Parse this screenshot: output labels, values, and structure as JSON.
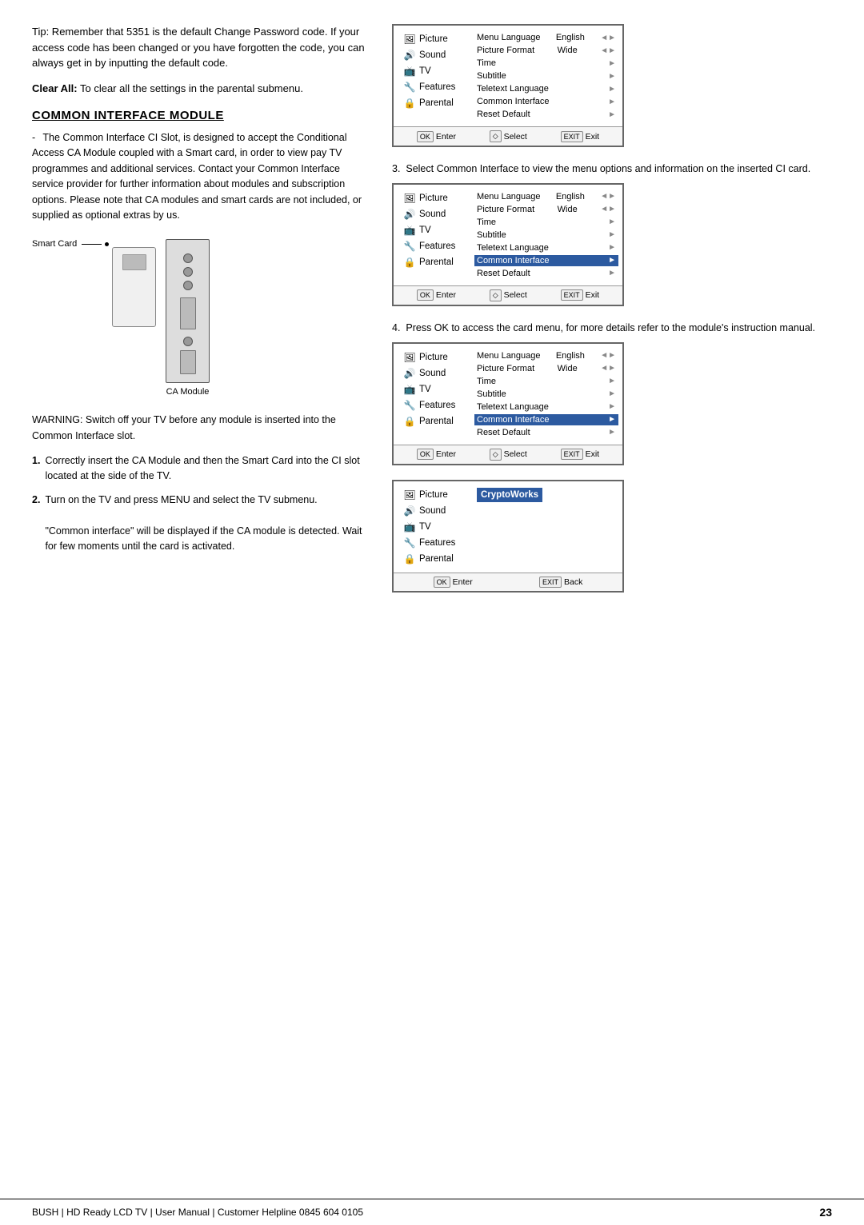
{
  "page": {
    "footer_text": "BUSH | HD Ready LCD TV | User Manual | Customer Helpline 0845 604 0105",
    "page_number": "23"
  },
  "left": {
    "tip": "Tip: Remember that 5351 is the default Change Password code. If your access code has been changed or you have forgotten the code, you can always get in by inputting the default code.",
    "clear_all_label": "Clear All:",
    "clear_all_text": "To clear all the settings in the parental submenu.",
    "section_heading": "COMMON INTERFACE MODULE",
    "body1": "The Common Interface CI Slot, is designed to accept the Conditional Access CA Module coupled with a Smart card, in order to view pay TV programmes and additional services. Contact your Common Interface service provider for further information about modules and subscription options. Please note that CA modules and smart cards are not included, or supplied as optional extras by us.",
    "smart_card_label": "Smart Card",
    "ca_module_label": "CA Module",
    "warning": "WARNING: Switch off your TV before any module is inserted into the Common Interface slot.",
    "step1": "Correctly insert the CA Module and then the Smart Card into the CI slot located at the side of the TV.",
    "step2": "Turn on the TV and press MENU and select the TV submenu.",
    "step2b": "\"Common interface\" will be displayed if the CA module is detected. Wait for few moments until the card is activated."
  },
  "menus": [
    {
      "id": "menu1",
      "step_text": "",
      "items_left": [
        {
          "label": "Picture",
          "icon": "🖼"
        },
        {
          "label": "Sound",
          "icon": "🔊"
        },
        {
          "label": "TV",
          "icon": "📺"
        },
        {
          "label": "Features",
          "icon": "🔧"
        },
        {
          "label": "Parental",
          "icon": "🔒"
        }
      ],
      "rows_right": [
        {
          "label": "Menu Language",
          "value": "English",
          "arrow": "◄►",
          "highlighted": false
        },
        {
          "label": "Picture Format",
          "value": "Wide",
          "arrow": "◄►",
          "highlighted": false
        },
        {
          "label": "Time",
          "value": "",
          "arrow": "►",
          "highlighted": false
        },
        {
          "label": "Subtitle",
          "value": "",
          "arrow": "►",
          "highlighted": false
        },
        {
          "label": "Teletext Language",
          "value": "",
          "arrow": "►",
          "highlighted": false
        },
        {
          "label": "Common Interface",
          "value": "",
          "arrow": "►",
          "highlighted": false
        },
        {
          "label": "Reset Default",
          "value": "",
          "arrow": "►",
          "highlighted": false
        }
      ],
      "footer": [
        {
          "key": "OK",
          "label": "Enter"
        },
        {
          "key": "◇",
          "label": "Select"
        },
        {
          "key": "EXIT",
          "label": "Exit"
        }
      ]
    },
    {
      "id": "menu2",
      "step_text": "Select Common Interface to view the menu options and information on the inserted CI card.",
      "items_left": [
        {
          "label": "Picture",
          "icon": "🖼"
        },
        {
          "label": "Sound",
          "icon": "🔊"
        },
        {
          "label": "TV",
          "icon": "📺"
        },
        {
          "label": "Features",
          "icon": "🔧"
        },
        {
          "label": "Parental",
          "icon": "🔒"
        }
      ],
      "rows_right": [
        {
          "label": "Menu Language",
          "value": "English",
          "arrow": "◄►",
          "highlighted": false
        },
        {
          "label": "Picture Format",
          "value": "Wide",
          "arrow": "◄►",
          "highlighted": false
        },
        {
          "label": "Time",
          "value": "",
          "arrow": "►",
          "highlighted": false
        },
        {
          "label": "Subtitle",
          "value": "",
          "arrow": "►",
          "highlighted": false
        },
        {
          "label": "Teletext Language",
          "value": "",
          "arrow": "►",
          "highlighted": false
        },
        {
          "label": "Common Interface",
          "value": "",
          "arrow": "►",
          "highlighted": true
        },
        {
          "label": "Reset Default",
          "value": "",
          "arrow": "►",
          "highlighted": false
        }
      ],
      "footer": [
        {
          "key": "OK",
          "label": "Enter"
        },
        {
          "key": "◇",
          "label": "Select"
        },
        {
          "key": "EXIT",
          "label": "Exit"
        }
      ]
    },
    {
      "id": "menu3",
      "step_text": "Press OK to access the card menu, for more details refer to the module's instruction manual.",
      "items_left": [
        {
          "label": "Picture",
          "icon": "🖼"
        },
        {
          "label": "Sound",
          "icon": "🔊"
        },
        {
          "label": "TV",
          "icon": "📺"
        },
        {
          "label": "Features",
          "icon": "🔧"
        },
        {
          "label": "Parental",
          "icon": "🔒"
        }
      ],
      "rows_right": [
        {
          "label": "Menu Language",
          "value": "English",
          "arrow": "◄►",
          "highlighted": false
        },
        {
          "label": "Picture Format",
          "value": "Wide",
          "arrow": "◄►",
          "highlighted": false
        },
        {
          "label": "Time",
          "value": "",
          "arrow": "►",
          "highlighted": false
        },
        {
          "label": "Subtitle",
          "value": "",
          "arrow": "►",
          "highlighted": false
        },
        {
          "label": "Teletext Language",
          "value": "",
          "arrow": "►",
          "highlighted": false
        },
        {
          "label": "Common Interface",
          "value": "",
          "arrow": "►",
          "highlighted": true
        },
        {
          "label": "Reset Default",
          "value": "",
          "arrow": "►",
          "highlighted": false
        }
      ],
      "footer": [
        {
          "key": "OK",
          "label": "Enter"
        },
        {
          "key": "◇",
          "label": "Select"
        },
        {
          "key": "EXIT",
          "label": "Exit"
        }
      ]
    },
    {
      "id": "menu4",
      "step_text": "",
      "items_left": [
        {
          "label": "Picture",
          "icon": "🖼"
        },
        {
          "label": "Sound",
          "icon": "🔊"
        },
        {
          "label": "TV",
          "icon": "📺"
        },
        {
          "label": "Features",
          "icon": "🔧"
        },
        {
          "label": "Parental",
          "icon": "🔒"
        }
      ],
      "crypto_label": "CryptoWorks",
      "footer": [
        {
          "key": "OK",
          "label": "Enter"
        },
        {
          "key": "EXIT",
          "label": "Back"
        }
      ]
    }
  ]
}
